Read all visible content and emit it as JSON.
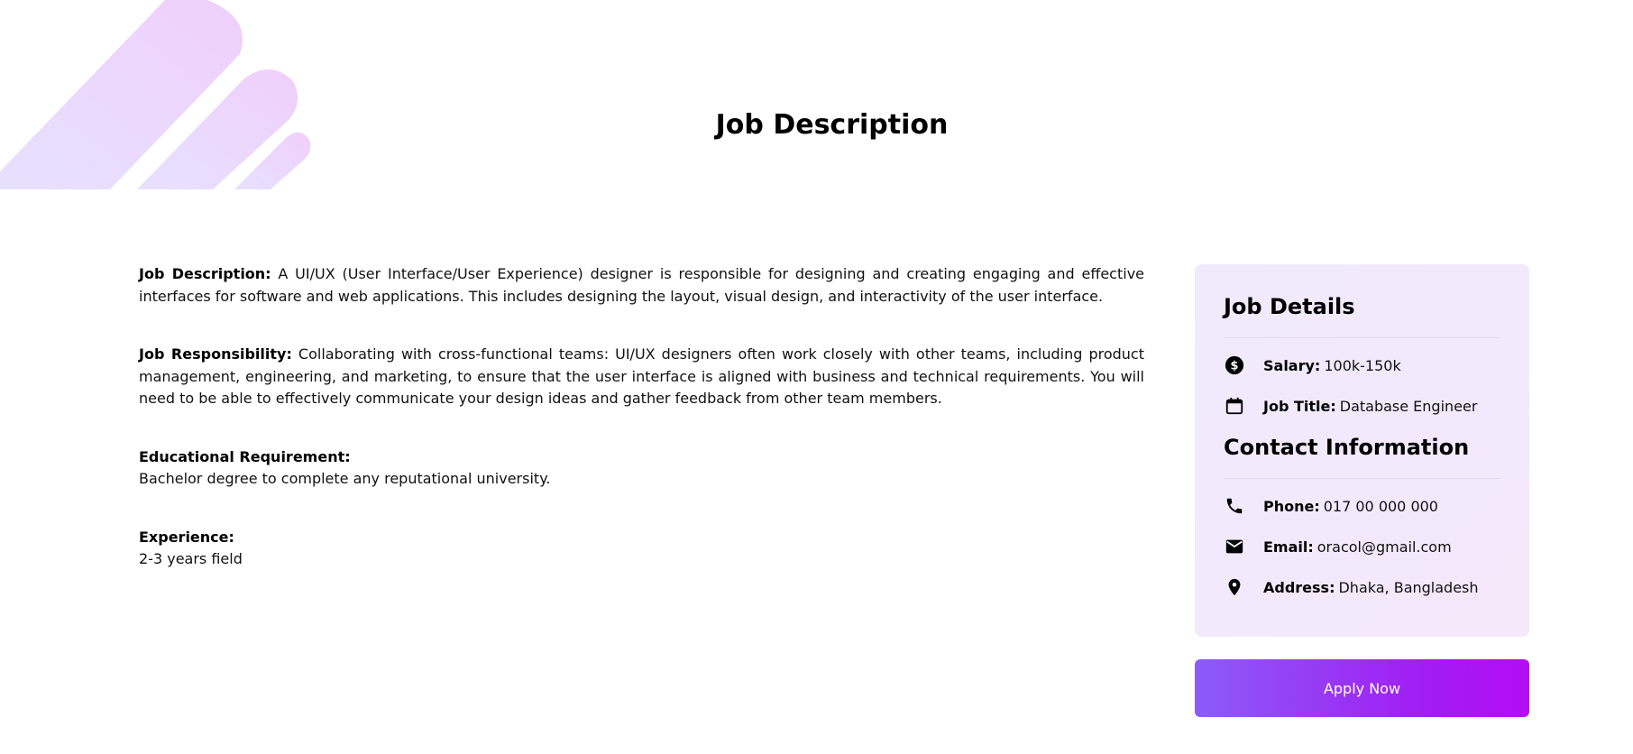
{
  "page": {
    "title": "Job Description"
  },
  "description": {
    "job_description": {
      "label": "Job Description:",
      "text": "A UI/UX (User Interface/User Experience) designer is responsible for designing and creating engaging and effective interfaces for software and web applications. This includes designing the layout, visual design, and interactivity of the user interface."
    },
    "job_responsibility": {
      "label": "Job Responsibility:",
      "text": "Collaborating with cross-functional teams: UI/UX designers often work closely with other teams, including product management, engineering, and marketing, to ensure that the user interface is aligned with business and technical requirements. You will need to be able to effectively communicate your design ideas and gather feedback from other team members."
    },
    "educational_requirement": {
      "label": "Educational Requirement:",
      "text": "Bachelor degree to complete any reputational university."
    },
    "experience": {
      "label": "Experience:",
      "text": "2-3 years field"
    }
  },
  "sidebar": {
    "job_details_heading": "Job Details",
    "salary": {
      "label": "Salary:",
      "value": "100k-150k",
      "icon": "dollar-circle-icon"
    },
    "job_title": {
      "label": "Job Title:",
      "value": "Database Engineer",
      "icon": "calendar-icon"
    },
    "contact_heading": "Contact Information",
    "phone": {
      "label": "Phone:",
      "value": "017 00 000 000",
      "icon": "phone-icon"
    },
    "email": {
      "label": "Email:",
      "value": "oracol@gmail.com",
      "icon": "envelope-icon"
    },
    "address": {
      "label": "Address:",
      "value": "Dhaka, Bangladesh",
      "icon": "location-pin-icon"
    }
  },
  "apply_button": {
    "label": "Apply Now"
  },
  "colors": {
    "accent_start": "#8b5cf6",
    "accent_end": "#b40df5",
    "sidebar_bg": "#f3e9fc"
  }
}
